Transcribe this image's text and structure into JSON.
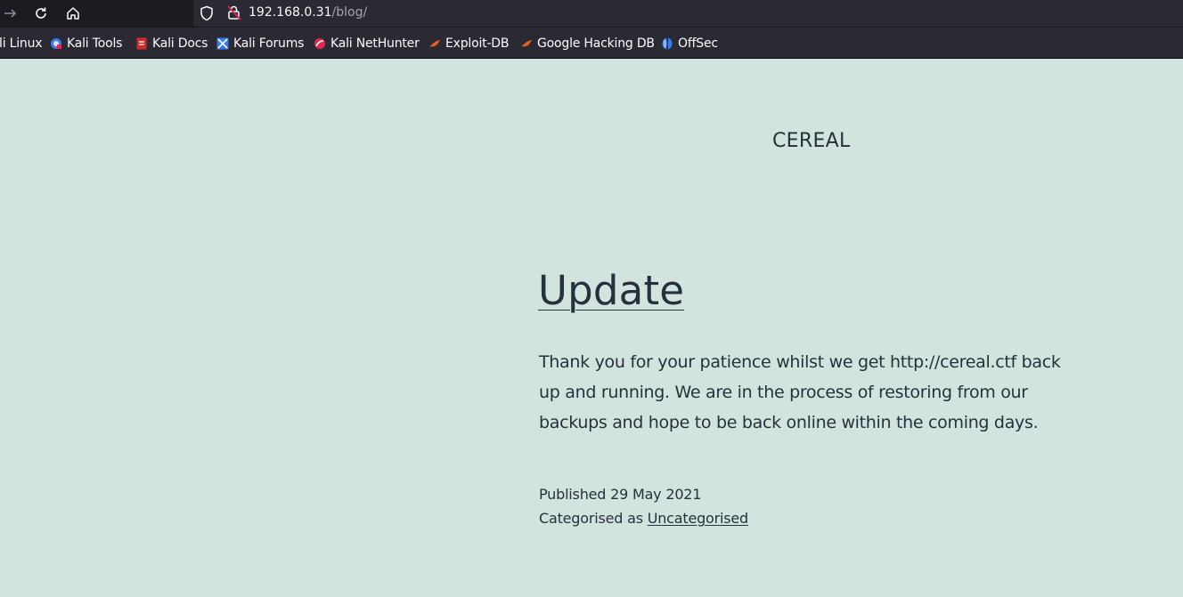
{
  "browser": {
    "url_host": "192.168.0.31",
    "url_path": "/blog/",
    "bookmarks": [
      {
        "label": "li Linux",
        "icon": "kali-linux-icon"
      },
      {
        "label": "Kali Tools",
        "icon": "kali-tools-icon"
      },
      {
        "label": "Kali Docs",
        "icon": "kali-docs-icon"
      },
      {
        "label": "Kali Forums",
        "icon": "kali-forums-icon"
      },
      {
        "label": "Kali NetHunter",
        "icon": "kali-nethunter-icon"
      },
      {
        "label": "Exploit-DB",
        "icon": "exploit-db-icon"
      },
      {
        "label": "Google Hacking DB",
        "icon": "google-hacking-db-icon"
      },
      {
        "label": "OffSec",
        "icon": "offsec-icon"
      }
    ]
  },
  "site": {
    "title": "CEREAL"
  },
  "post": {
    "title": "Update",
    "body": "Thank you for your patience whilst we get http://cereal.ctf back up and running. We are in the process of restoring from our backups and hope to be back online within the coming days.",
    "published_prefix": "Published",
    "published_date": "29 May 2021",
    "category_prefix": "Categorised as",
    "category": "Uncategorised"
  },
  "colors": {
    "page_background": "#d1e4dd",
    "text": "#28303d",
    "chrome_dark": "#1c1b22",
    "chrome_bar": "#2b2a33"
  }
}
